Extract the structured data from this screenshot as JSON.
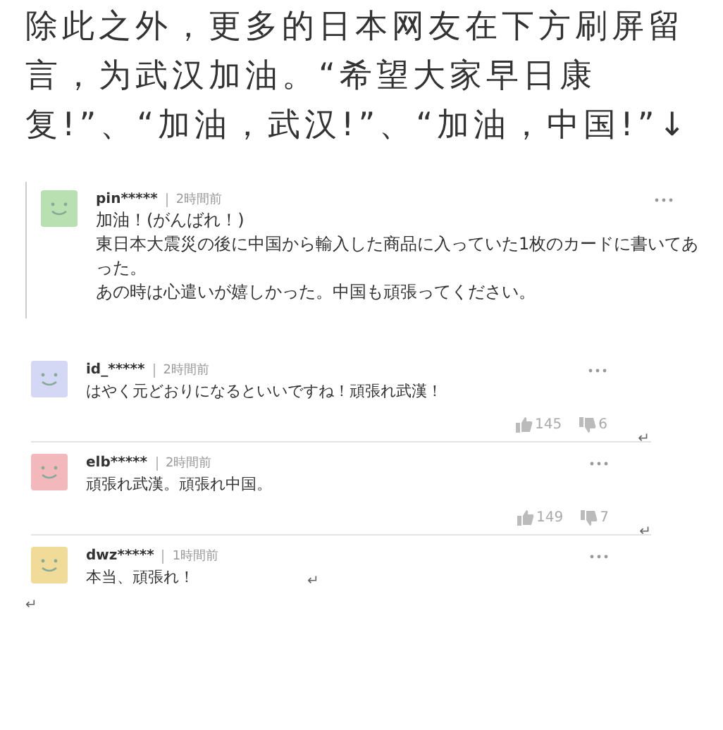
{
  "intro": "除此之外，更多的日本网友在下方刷屏留言，为武汉加油。“希望大家早日康复!”、“加油，武汉!”、“加油，中国!”↓",
  "comments": [
    {
      "kind": "quoted",
      "user": "pin*****",
      "time": "2時間前",
      "color": "#b8e0b0",
      "body": [
        "加油！(がんばれ！)",
        "東日本大震災の後に中国から輸入した商品に入っていた1枚のカードに書いてあった。",
        "あの時は心遣いが嬉しかった。中国も頑張ってください。"
      ]
    },
    {
      "kind": "plain",
      "user": "id_*****",
      "time": "2時間前",
      "color": "#d4d8f4",
      "body": [
        "はやく元どおりになるといいですね！頑張れ武漢！"
      ],
      "likes": "145",
      "dislikes": "6",
      "return_mark": "↵"
    },
    {
      "kind": "plain",
      "user": "elb*****",
      "time": "2時間前",
      "color": "#f2b8bc",
      "body": [
        "頑張れ武漢。頑張れ中国。"
      ],
      "likes": "149",
      "dislikes": "7",
      "return_mark": "↵"
    },
    {
      "kind": "plain",
      "user": "dwz*****",
      "time": "1時間前",
      "color": "#f0dc98",
      "body": [
        "本当、頑張れ！"
      ],
      "body_mark": "↵"
    }
  ],
  "end_mark": "↵"
}
